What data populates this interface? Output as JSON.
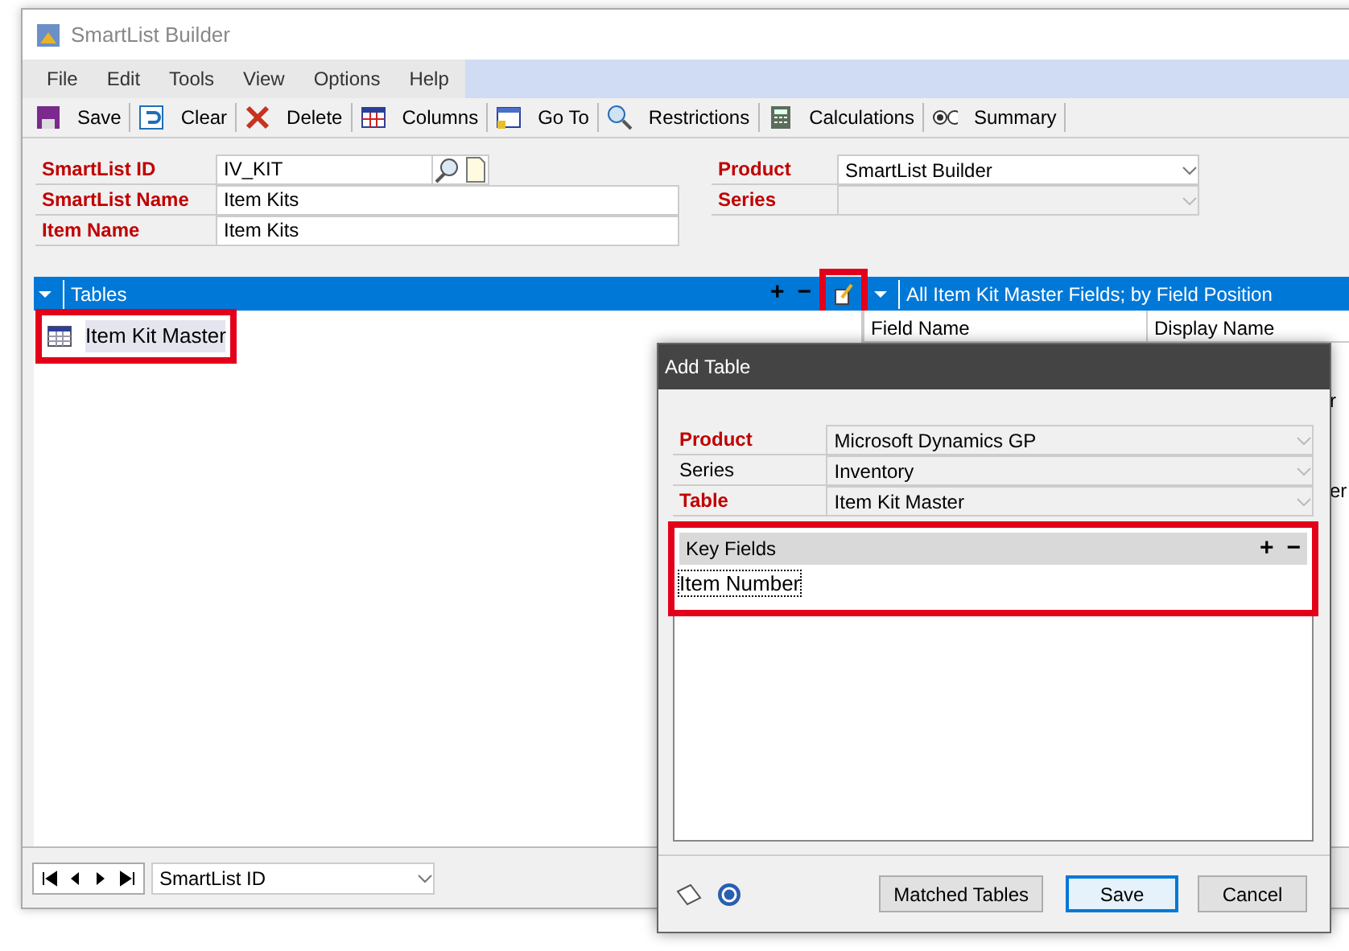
{
  "window": {
    "title": "SmartList Builder"
  },
  "menu": [
    "File",
    "Edit",
    "Tools",
    "View",
    "Options",
    "Help"
  ],
  "toolbar": [
    {
      "label": "Save",
      "kind": "save"
    },
    {
      "label": "Clear",
      "kind": "undo"
    },
    {
      "label": "Delete",
      "kind": "delete"
    },
    {
      "label": "Columns",
      "kind": "columns"
    },
    {
      "label": "Go To",
      "kind": "goto"
    },
    {
      "label": "Restrictions",
      "kind": "search"
    },
    {
      "label": "Calculations",
      "kind": "calculator"
    },
    {
      "label": "Summary",
      "kind": "radio"
    }
  ],
  "form_left": [
    {
      "label": "SmartList ID",
      "value": "IV_KIT",
      "lookup": true
    },
    {
      "label": "SmartList Name",
      "value": "Item Kits",
      "lookup": false
    },
    {
      "label": "Item Name",
      "value": "Item Kits",
      "lookup": false
    }
  ],
  "form_right": [
    {
      "label": "Product",
      "value": "SmartList Builder",
      "disabled": false
    },
    {
      "label": "Series",
      "disabled": true
    }
  ],
  "tables_pane": {
    "title": "Tables",
    "add": "+",
    "remove": "−",
    "edit_highlighted": true,
    "items": [
      {
        "label": "Item Kit Master",
        "selected": true,
        "highlighted": true
      }
    ]
  },
  "fields_pane": {
    "title": "All Item Kit Master Fields; by Field Position",
    "columns": [
      "Field Name",
      "Display Name"
    ],
    "cut_texts": [
      "r",
      "er"
    ]
  },
  "navigation": {
    "field": "SmartList ID"
  },
  "dialog": {
    "title": "Add Table",
    "fields": [
      {
        "label": "Product",
        "value": "Microsoft Dynamics GP",
        "required": true
      },
      {
        "label": "Series",
        "value": "Inventory",
        "required": false
      },
      {
        "label": "Table",
        "value": "Item Kit Master",
        "required": true
      }
    ],
    "key_fields": {
      "title": "Key Fields",
      "add": "+",
      "remove": "−",
      "highlighted": true,
      "items": [
        {
          "label": "Item Number",
          "selected": true
        }
      ]
    },
    "buttons": [
      {
        "label": "Matched Tables",
        "default": false
      },
      {
        "label": "Save",
        "default": true
      },
      {
        "label": "Cancel",
        "default": false
      }
    ]
  }
}
